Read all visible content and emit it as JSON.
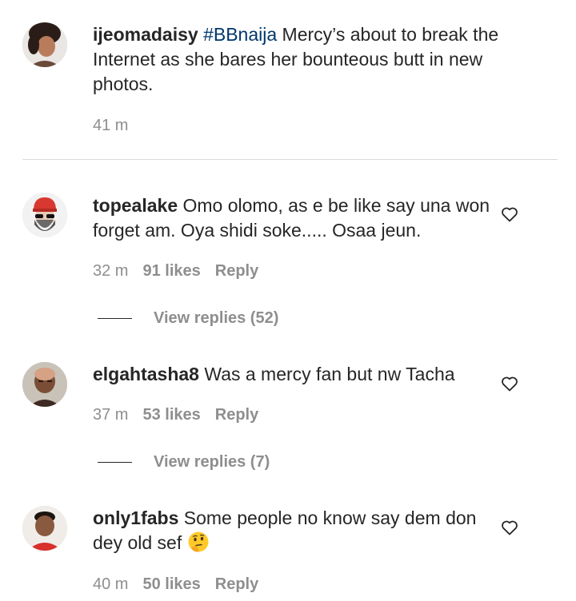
{
  "caption": {
    "username": "ijeomadaisy",
    "hashtag": "#BBnaija",
    "text": " Mercy’s about to break the Internet as she bares her bounteous butt in new photos.",
    "time": "41 m",
    "avatar_icon": "avatar-photo-woman"
  },
  "comments": [
    {
      "username": "topealake",
      "text": " Omo olomo, as e be like say una won forget am. Oya shidi soke..... Osaa jeun.",
      "time": "32 m",
      "likes": "91 likes",
      "reply_label": "Reply",
      "view_replies": "View replies (52)",
      "avatar_icon": "avatar-bearded-man-red-cap"
    },
    {
      "username": "elgahtasha8",
      "text": " Was a mercy fan but nw Tacha",
      "time": "37 m",
      "likes": "53 likes",
      "reply_label": "Reply",
      "view_replies": "View replies (7)",
      "avatar_icon": "avatar-photo-woman-bald"
    },
    {
      "username": "only1fabs",
      "text": " Some people no know say dem don dey old sef",
      "emoji": "thinking-face-emoji",
      "time": "40 m",
      "likes": "50 likes",
      "reply_label": "Reply",
      "avatar_icon": "avatar-photo-man-red-shirt"
    }
  ],
  "icons": {
    "like": "heart-outline-icon"
  },
  "colors": {
    "text": "#262626",
    "secondary": "#8e8e8e",
    "hashtag": "#00376b",
    "divider": "#dbdbdb"
  }
}
